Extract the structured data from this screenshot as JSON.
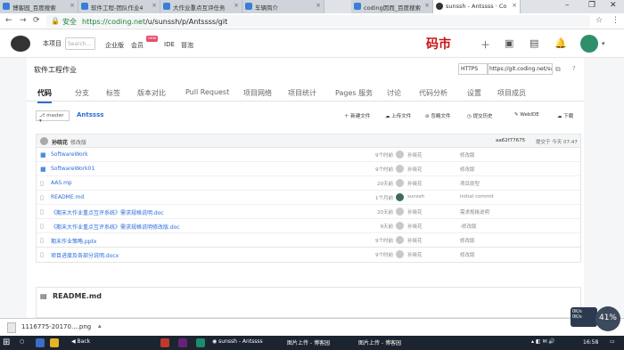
{
  "browser": {
    "tabs": [
      {
        "label": "博客园_百度搜索"
      },
      {
        "label": "软件工程-团队作业4"
      },
      {
        "label": "大作业重点互评任务"
      },
      {
        "label": "车辆简介"
      },
      {
        "label": "coding因而_百度搜索"
      },
      {
        "label": "sunssh - Antssss · Co"
      }
    ],
    "secure_label": "安全",
    "url_host": "https://coding.net",
    "url_path": "/u/sunssh/p/Antssss/git"
  },
  "appbar": {
    "project_label": "本项目",
    "search_placeholder": "Search...",
    "nav": [
      "企业版",
      "会员",
      "IDE",
      "冒泡"
    ],
    "new_badge": "new",
    "brand": "码市"
  },
  "project": {
    "title": "软件工程作业",
    "protocol": "HTTPS",
    "git_url": "https://git.coding.net/su",
    "tabs": [
      "代码",
      "分支",
      "标签",
      "版本对比",
      "Pull Request",
      "项目网络",
      "项目统计",
      "Pages 服务",
      "讨论",
      "代码分析",
      "设置",
      "项目成员"
    ]
  },
  "repo": {
    "branch": "master",
    "name": "Antssss",
    "actions": [
      "新建文件",
      "上传文件",
      "忽略文件",
      "提交历史",
      "WebIDE",
      "下载"
    ],
    "last_commit": {
      "author": "孙晓花",
      "message": "修改版",
      "hash": "aa62f77675",
      "when": "提交于 今天 07:47"
    },
    "files": [
      {
        "type": "folder",
        "name": "SoftwareWork",
        "time": "9个时前",
        "author": "孙晓花",
        "message": "修改版"
      },
      {
        "type": "folder",
        "name": "SoftwareWork01",
        "time": "9个时前",
        "author": "孙晓花",
        "message": "修改版"
      },
      {
        "type": "file",
        "name": "AAS.mp",
        "time": "20天前",
        "author": "孙晓花",
        "message": "项目原型"
      },
      {
        "type": "file",
        "name": "README.md",
        "time": "1个月前",
        "author": "sunssh",
        "message": "Initial commit"
      },
      {
        "type": "file",
        "name": "《期末大作业重点互评系统》需求规格说明.doc",
        "time": "20天前",
        "author": "孙晓花",
        "message": "需求规格说明"
      },
      {
        "type": "file",
        "name": "《期末大作业重点互评系统》需求规格说明修改版.doc",
        "time": "9天前",
        "author": "孙晓花",
        "message": "-修改版"
      },
      {
        "type": "file",
        "name": "期末作业策略.pptx",
        "time": "9个时前",
        "author": "孙晓花",
        "message": "修改版"
      },
      {
        "type": "file",
        "name": "项目进度及各部分说明.docx",
        "time": "9个时前",
        "author": "孙晓花",
        "message": "修改版"
      }
    ],
    "readme_title": "README.md"
  },
  "download_bar": {
    "filename": "1116775-20170....png"
  },
  "taskbar": {
    "apps": [
      "Back",
      "sunssh - Antssss",
      "图片上传 - 博客园",
      "图片上传 - 博客园"
    ],
    "time": "16:58"
  },
  "speed_indicator": "41%",
  "net_speed": [
    "0K/s",
    "0K/s"
  ]
}
